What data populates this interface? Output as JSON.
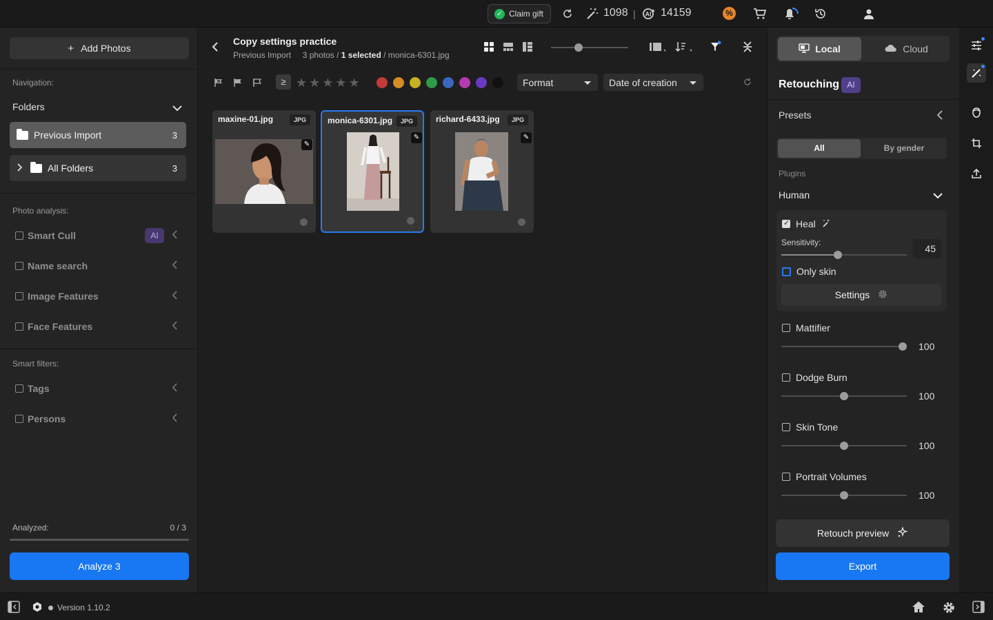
{
  "topbar": {
    "claim_gift": "Claim gift",
    "credits_magic": "1098",
    "separator": "|",
    "credits_ai": "14159"
  },
  "left": {
    "add_photos": "Add Photos",
    "navigation_label": "Navigation:",
    "folders_label": "Folders",
    "folders": [
      {
        "name": "Previous Import",
        "count": "3"
      },
      {
        "name": "All Folders",
        "count": "3"
      }
    ],
    "photo_analysis_label": "Photo analysis:",
    "analysis_items": [
      {
        "label": "Smart Cull",
        "badge": "AI"
      },
      {
        "label": "Name search"
      },
      {
        "label": "Image Features"
      },
      {
        "label": "Face Features"
      }
    ],
    "smart_filters_label": "Smart filters:",
    "smart_filters": [
      {
        "label": "Tags"
      },
      {
        "label": "Persons"
      }
    ],
    "analyzed_label": "Analyzed:",
    "analyzed_value": "0 / 3",
    "analyzed_progress": 0,
    "analyze_button": "Analyze 3"
  },
  "center": {
    "title": "Copy settings practice",
    "sub_folder": "Previous Import",
    "sub_count": "3 photos /",
    "sub_selected": "1 selected",
    "sub_file": "/ monica-6301.jpg",
    "greater_equal": "≥",
    "format_dropdown": "Format",
    "sort_dropdown": "Date of creation",
    "color_labels": [
      "#c43a3a",
      "#d58d22",
      "#c4b222",
      "#2f9a47",
      "#3a66c2",
      "#b53ab0",
      "#6a3ac2",
      "#111111"
    ],
    "photos": [
      {
        "name": "maxine-01.jpg",
        "format": "JPG",
        "selected": false
      },
      {
        "name": "monica-6301.jpg",
        "format": "JPG",
        "selected": true
      },
      {
        "name": "richard-6433.jpg",
        "format": "JPG",
        "selected": false
      }
    ]
  },
  "right": {
    "local": "Local",
    "cloud": "Cloud",
    "retouching": "Retouching",
    "ai": "AI",
    "presets": "Presets",
    "seg_all": "All",
    "seg_gender": "By gender",
    "plugins_label": "Plugins",
    "human": "Human",
    "heal": "Heal",
    "sensitivity_label": "Sensitivity:",
    "sensitivity_value": "45",
    "only_skin": "Only skin",
    "settings": "Settings",
    "plugins": [
      {
        "label": "Mattifier",
        "value": "100"
      },
      {
        "label": "Dodge Burn",
        "value": "100"
      },
      {
        "label": "Skin Tone",
        "value": "100"
      },
      {
        "label": "Portrait Volumes",
        "value": "100"
      }
    ],
    "retouch_preview": "Retouch preview",
    "export": "Export"
  },
  "bottom": {
    "version": "Version 1.10.2"
  }
}
